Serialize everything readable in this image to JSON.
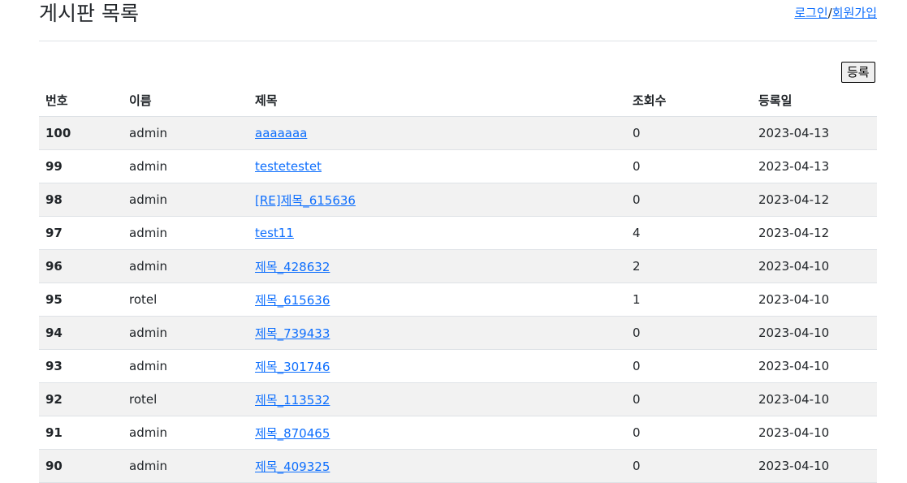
{
  "header": {
    "title": "게시판 목록",
    "login_label": "로그인",
    "separator": "/",
    "signup_label": "회원가입"
  },
  "toolbar": {
    "register_label": "등록"
  },
  "table": {
    "columns": [
      "번호",
      "이름",
      "제목",
      "조회수",
      "등록일"
    ],
    "rows": [
      {
        "no": "100",
        "name": "admin",
        "title": "aaaaaaa",
        "views": "0",
        "date": "2023-04-13"
      },
      {
        "no": "99",
        "name": "admin",
        "title": "testetestet",
        "views": "0",
        "date": "2023-04-13"
      },
      {
        "no": "98",
        "name": "admin",
        "title": "[RE]제목_615636",
        "views": "0",
        "date": "2023-04-12"
      },
      {
        "no": "97",
        "name": "admin",
        "title": "test11",
        "views": "4",
        "date": "2023-04-12"
      },
      {
        "no": "96",
        "name": "admin",
        "title": "제목_428632",
        "views": "2",
        "date": "2023-04-10"
      },
      {
        "no": "95",
        "name": "rotel",
        "title": "제목_615636",
        "views": "1",
        "date": "2023-04-10"
      },
      {
        "no": "94",
        "name": "admin",
        "title": "제목_739433",
        "views": "0",
        "date": "2023-04-10"
      },
      {
        "no": "93",
        "name": "admin",
        "title": "제목_301746",
        "views": "0",
        "date": "2023-04-10"
      },
      {
        "no": "92",
        "name": "rotel",
        "title": "제목_113532",
        "views": "0",
        "date": "2023-04-10"
      },
      {
        "no": "91",
        "name": "admin",
        "title": "제목_870465",
        "views": "0",
        "date": "2023-04-10"
      },
      {
        "no": "90",
        "name": "admin",
        "title": "제목_409325",
        "views": "0",
        "date": "2023-04-10"
      }
    ]
  }
}
